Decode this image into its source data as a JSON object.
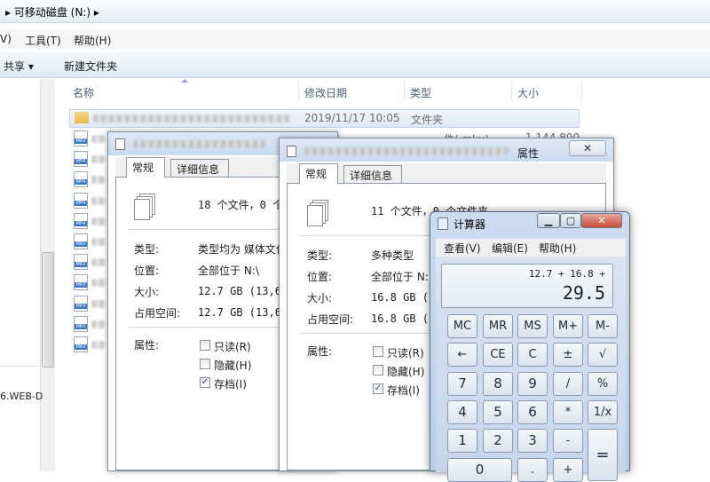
{
  "explorer": {
    "address": "▸ 可移动磁盘 (N:) ▸",
    "menu": [
      "V)",
      "工具(T)",
      "帮助(H)"
    ],
    "toolbar": {
      "share": "共享 ▾",
      "new_folder": "新建文件夹"
    },
    "columns": {
      "name": "名称",
      "date": "修改日期",
      "type": "类型",
      "size": "大小"
    },
    "row1": {
      "date": "2019/11/17 10:05",
      "type": "文件夹"
    },
    "row2": {
      "type": "件(.mkv)",
      "size": "1,144,800"
    },
    "file_icon_labels": [
      "MKV",
      "MP4",
      "MP4",
      "MP4",
      "MP4",
      "MKV",
      "MKV",
      "MKV",
      "MKV",
      "MKV",
      "MKV"
    ],
    "nav_bottom_text": "6.WEB-D"
  },
  "dialog1": {
    "tabs": [
      "常规",
      "详细信息"
    ],
    "summary": "18 个文件，0 个文",
    "labels": [
      "类型:",
      "位置:",
      "大小:",
      "占用空间:",
      "属性:"
    ],
    "type_val": "类型均为 媒体文件",
    "loc_val": "全部位于 N:\\",
    "size_val": "12.7 GB (13,641,",
    "disk_val": "12.7 GB (13,641,",
    "attrs": [
      "只读(R)",
      "隐藏(H)",
      "存档(I)"
    ]
  },
  "dialog2": {
    "title_suffix": "属性",
    "close": "✕",
    "tabs": [
      "常规",
      "详细信息"
    ],
    "summary": "11 个文件，0 个文件夹",
    "labels": [
      "类型:",
      "位置:",
      "大小:",
      "占用空间:",
      "属性:"
    ],
    "type_val": "多种类型",
    "loc_val": "全部位于 N:",
    "size_val": "16.8 GB (18",
    "disk_val": "16.8 GB (18",
    "attrs": [
      "只读(R)",
      "隐藏(H)",
      "存档(I)"
    ]
  },
  "calculator": {
    "title": "计算器",
    "menu": [
      "查看(V)",
      "编辑(E)",
      "帮助(H)"
    ],
    "expression": "12.7 + 16.8 +",
    "result": "29.5",
    "rows": [
      [
        "MC",
        "MR",
        "MS",
        "M+",
        "M-"
      ],
      [
        "←",
        "CE",
        "C",
        "±",
        "√"
      ],
      [
        "7",
        "8",
        "9",
        "/",
        "%"
      ],
      [
        "4",
        "5",
        "6",
        "*",
        "1/x"
      ],
      [
        "1",
        "2",
        "3",
        "-",
        "="
      ],
      [
        "0",
        ".",
        "+"
      ]
    ]
  }
}
